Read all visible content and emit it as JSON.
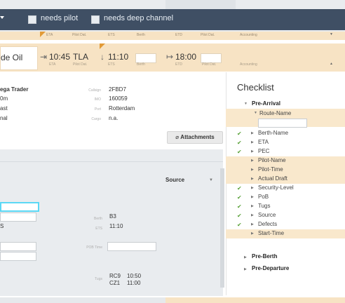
{
  "filters": {
    "items": [
      {
        "label": "needs pilot"
      },
      {
        "label": "needs deep channel"
      }
    ]
  },
  "strip_columns": [
    "ETA",
    "Pilot Dat.",
    "ETS",
    "Berth",
    "ETD",
    "Pilot Dat.",
    "Accounting"
  ],
  "vessel": {
    "name_partial": "de Oil",
    "eta_time": "10:45",
    "eta_label": "ETA",
    "pilot_label": "Pilot Dat.",
    "tla": "TLA",
    "ets_time": "11:10",
    "ets_label": "ETS",
    "berth_label": "Berth",
    "etd_time": "18:00",
    "etd_label": "ETD",
    "pilot2_label": "Pilot Dat.",
    "accounting_label": "Accounting"
  },
  "details": {
    "left": [
      "ega Trader",
      "0m",
      "ast",
      "nal"
    ],
    "callsign_label": "Callsign",
    "callsign": "2FBD7",
    "imo_label": "IMO",
    "imo": "160059",
    "port_label": "Port",
    "port": "Rotterdam",
    "other_label": "Cargo",
    "other": "n.a."
  },
  "attachments_label": "Attachments",
  "section2": {
    "source_label": "Source",
    "left_value": "S",
    "berth_label": "Berth",
    "berth_value": "B3",
    "ets_label": "ETS",
    "ets_value": "11:10",
    "pob_label": "POB Time",
    "tugs_label": "Tugs",
    "tugs": [
      {
        "name": "RC9",
        "time": "10:50"
      },
      {
        "name": "CZ1",
        "time": "11:00"
      }
    ]
  },
  "checklist": {
    "title": "Checklist",
    "pre_arrival": "Pre-Arrival",
    "route_name": "Route-Name",
    "items": [
      {
        "label": "Berth-Name",
        "checked": true,
        "highlight": false
      },
      {
        "label": "ETA",
        "checked": true,
        "highlight": false
      },
      {
        "label": "PEC",
        "checked": true,
        "highlight": false
      },
      {
        "label": "Pilot-Name",
        "checked": false,
        "highlight": true
      },
      {
        "label": "Pilot-Time",
        "checked": false,
        "highlight": true
      },
      {
        "label": "Actual Draft",
        "checked": false,
        "highlight": true
      },
      {
        "label": "Security-Level",
        "checked": true,
        "highlight": false
      },
      {
        "label": "PoB",
        "checked": true,
        "highlight": false
      },
      {
        "label": "Tugs",
        "checked": true,
        "highlight": false
      },
      {
        "label": "Source",
        "checked": true,
        "highlight": false
      },
      {
        "label": "Defects",
        "checked": true,
        "highlight": false
      },
      {
        "label": "Start-Time",
        "checked": false,
        "highlight": true
      }
    ],
    "pre_berth": "Pre-Berth",
    "pre_departure": "Pre-Departure"
  },
  "colors": {
    "accent_orange": "#e29a36",
    "focus_cyan": "#5bd8f5",
    "check_green": "#5aa23a"
  }
}
